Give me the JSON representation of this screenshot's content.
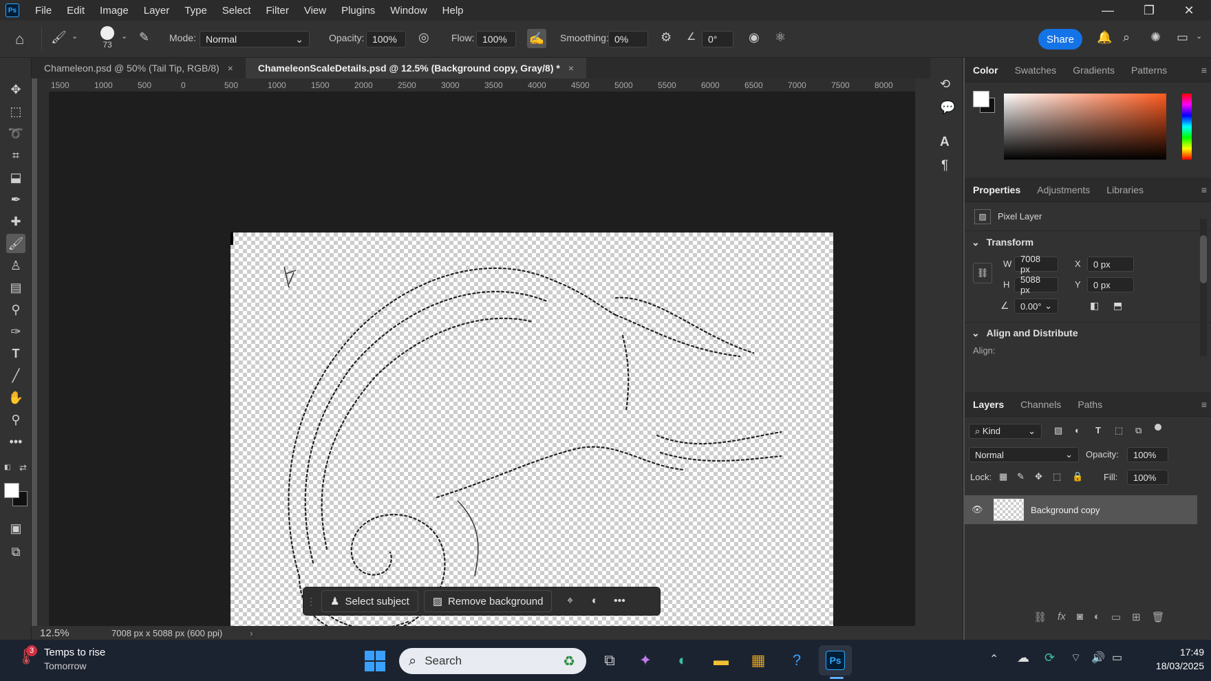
{
  "menubar": {
    "app_icon": "Ps",
    "items": [
      "File",
      "Edit",
      "Image",
      "Layer",
      "Type",
      "Select",
      "Filter",
      "View",
      "Plugins",
      "Window",
      "Help"
    ]
  },
  "options": {
    "brush_size": "73",
    "mode_label": "Mode:",
    "mode_value": "Normal",
    "opacity_label": "Opacity:",
    "opacity_value": "100%",
    "flow_label": "Flow:",
    "flow_value": "100%",
    "smoothing_label": "Smoothing:",
    "smoothing_value": "0%",
    "angle_value": "0°",
    "share_label": "Share"
  },
  "tabs": [
    {
      "label": "Chameleon.psd @ 50% (Tail Tip, RGB/8)",
      "close": "×"
    },
    {
      "label": "ChameleonScaleDetails.psd @ 12.5% (Background copy, Gray/8) *",
      "close": "×"
    }
  ],
  "ruler": {
    "ticks": [
      "1500",
      "1000",
      "500",
      "0",
      "500",
      "1000",
      "1500",
      "2000",
      "2500",
      "3000",
      "3500",
      "4000",
      "4500",
      "5000",
      "5500",
      "6000",
      "6500",
      "7000",
      "7500",
      "8000"
    ]
  },
  "context_bar": {
    "select_subject": "Select subject",
    "remove_background": "Remove background"
  },
  "status": {
    "zoom": "12.5%",
    "doc_info": "7008 px x 5088 px (600 ppi)"
  },
  "color_panel": {
    "tabs": [
      "Color",
      "Swatches",
      "Gradients",
      "Patterns"
    ]
  },
  "properties_panel": {
    "tabs": [
      "Properties",
      "Adjustments",
      "Libraries"
    ],
    "layer_type": "Pixel Layer",
    "transform_title": "Transform",
    "w_label": "W",
    "w_value": "7008 px",
    "h_label": "H",
    "h_value": "5088 px",
    "x_label": "X",
    "x_value": "0 px",
    "y_label": "Y",
    "y_value": "0 px",
    "angle_value": "0.00°",
    "align_title": "Align and Distribute",
    "align_label": "Align:"
  },
  "layers_panel": {
    "tabs": [
      "Layers",
      "Channels",
      "Paths"
    ],
    "filter_kind": "Kind",
    "blend_mode": "Normal",
    "opacity_label": "Opacity:",
    "opacity_value": "100%",
    "lock_label": "Lock:",
    "fill_label": "Fill:",
    "fill_value": "100%",
    "layers": [
      {
        "name": "Background copy"
      }
    ]
  },
  "taskbar": {
    "weather_badge": "3",
    "weather_title": "Temps to rise",
    "weather_sub": "Tomorrow",
    "search_placeholder": "Search",
    "ps_label": "Ps",
    "time": "17:49",
    "date": "18/03/2025"
  },
  "colors": {
    "accent": "#1473e6",
    "ps_blue": "#31a8ff"
  }
}
